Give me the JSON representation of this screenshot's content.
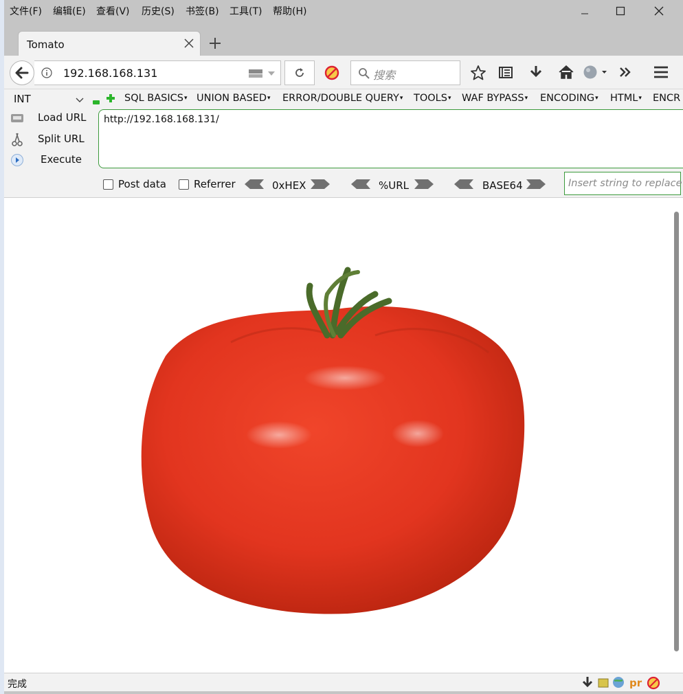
{
  "menu": [
    "文件(F)",
    "编辑(E)",
    "查看(V)",
    "历史(S)",
    "书签(B)",
    "工具(T)",
    "帮助(H)"
  ],
  "tab": {
    "title": "Tomato"
  },
  "nav": {
    "url": "192.168.168.131",
    "search_placeholder": "搜索"
  },
  "hackbar": {
    "int_select": "INT",
    "menus": [
      "SQL BASICS",
      "UNION BASED",
      "ERROR/DOUBLE QUERY",
      "TOOLS",
      "WAF BYPASS",
      "ENCODING",
      "HTML",
      "ENCR"
    ],
    "load_url": "Load URL",
    "split_url": "Split URL",
    "execute": "Execute",
    "url_value": "http://192.168.168.131/",
    "post_data": "Post data",
    "referrer": "Referrer",
    "hex": "0xHEX",
    "urlenc": "%URL",
    "base64": "BASE64",
    "replace_placeholder": "Insert string to replace"
  },
  "status": {
    "text": "完成"
  },
  "colors": {
    "tomato": "#e2351f",
    "accent_green": "#3c9a3c"
  }
}
